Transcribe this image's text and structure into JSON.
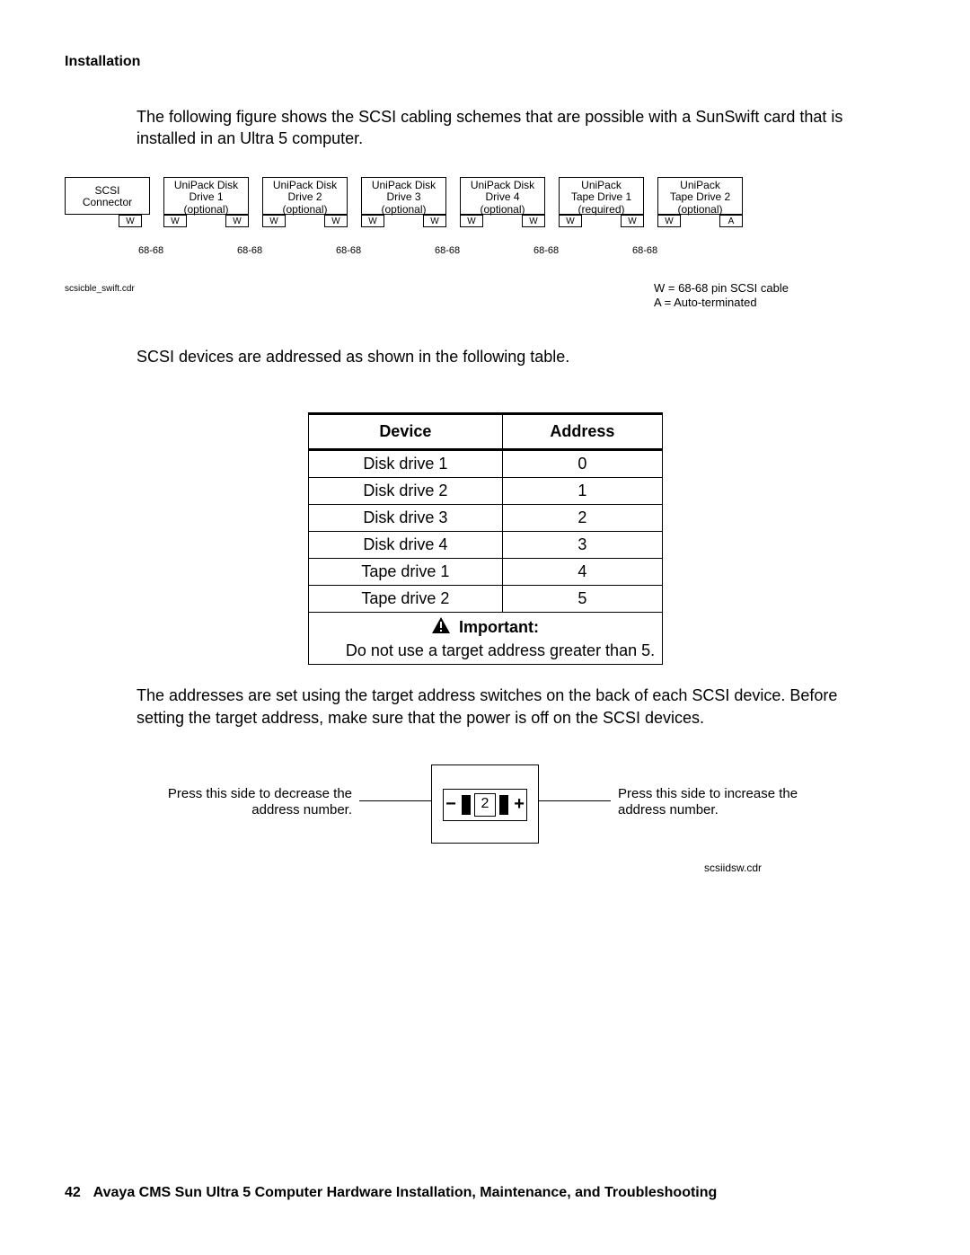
{
  "section_label": "Installation",
  "intro_text": "The following figure shows the SCSI cabling schemes that are possible with a SunSwift card that is installed in an Ultra 5 computer.",
  "diagram": {
    "boxes": [
      {
        "l1": "SCSI",
        "l2": "Connector",
        "l3": ""
      },
      {
        "l1": "UniPack Disk",
        "l2": "Drive 1",
        "l3": "(optional)"
      },
      {
        "l1": "UniPack Disk",
        "l2": "Drive 2",
        "l3": "(optional)"
      },
      {
        "l1": "UniPack Disk",
        "l2": "Drive 3",
        "l3": "(optional)"
      },
      {
        "l1": "UniPack Disk",
        "l2": "Drive 4",
        "l3": "(optional)"
      },
      {
        "l1": "UniPack",
        "l2": "Tape Drive 1",
        "l3": "(required)"
      },
      {
        "l1": "UniPack",
        "l2": "Tape Drive 2",
        "l3": "(optional)"
      }
    ],
    "port_W": "W",
    "port_A": "A",
    "conn_label": "68-68",
    "fig_file": "scsicble_swift.cdr",
    "legend_w": "W = 68-68 pin SCSI cable",
    "legend_a": "A  = Auto-terminated"
  },
  "mid_text": "SCSI devices are addressed as shown in the following table.",
  "table": {
    "h_device": "Device",
    "h_address": "Address",
    "rows": [
      {
        "device": "Disk drive 1",
        "addr": "0"
      },
      {
        "device": "Disk drive 2",
        "addr": "1"
      },
      {
        "device": "Disk drive 3",
        "addr": "2"
      },
      {
        "device": "Disk drive 4",
        "addr": "3"
      },
      {
        "device": "Tape drive 1",
        "addr": "4"
      },
      {
        "device": "Tape drive 2",
        "addr": "5"
      }
    ],
    "important_label": "Important:",
    "important_text": "Do not use a target address greater than 5."
  },
  "after_table_text": "The addresses are set using the target address switches on the back of each SCSI device. Before setting the target address, make sure that the power is off on the SCSI devices.",
  "switch": {
    "left_label": "Press this side to decrease the address number.",
    "right_label": "Press this side to increase the address number.",
    "minus": "−",
    "plus": "+",
    "number": "2",
    "file": "scsiidsw.cdr"
  },
  "footer": {
    "page": "42",
    "title": "Avaya CMS Sun Ultra 5 Computer Hardware Installation, Maintenance, and Troubleshooting"
  }
}
